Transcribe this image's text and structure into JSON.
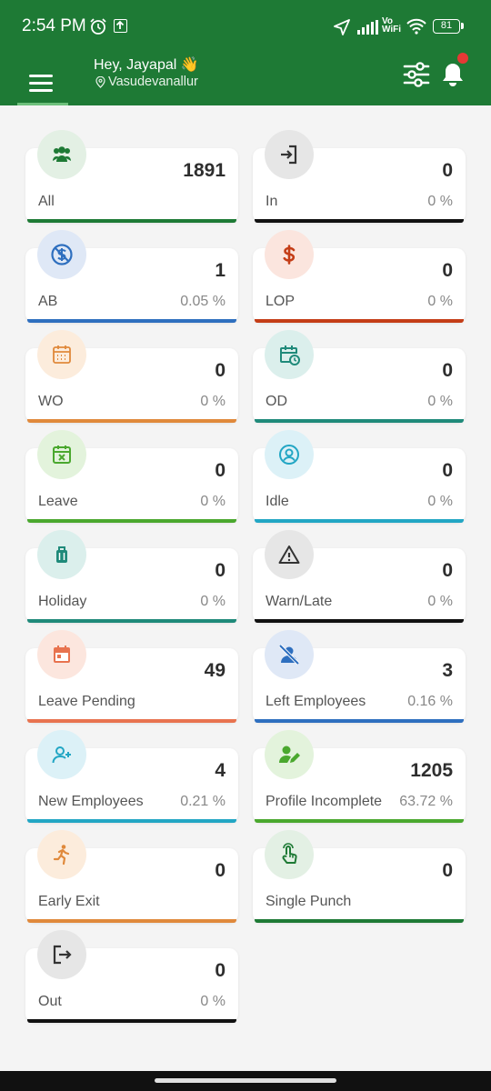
{
  "status_bar": {
    "time": "2:54 PM",
    "network": "Vo\nWiFi",
    "battery": "81"
  },
  "header": {
    "greeting": "Hey, Jayapal 👋",
    "location": "Vasudevanallur"
  },
  "colors": {
    "brand": "#1e7a35"
  },
  "cards": [
    {
      "label": "All",
      "count": "1891",
      "percent": "",
      "icon": "people-icon",
      "bar": "#1e7a35",
      "bg": "#e3f0e4",
      "fg": "#1e7a35"
    },
    {
      "label": "In",
      "count": "0",
      "percent": "0 %",
      "icon": "login-icon",
      "bar": "#111111",
      "bg": "#e6e6e6",
      "fg": "#333333"
    },
    {
      "label": "AB",
      "count": "1",
      "percent": "0.05 %",
      "icon": "absent-icon",
      "bar": "#2e6fbf",
      "bg": "#dfe8f6",
      "fg": "#2e6fbf"
    },
    {
      "label": "LOP",
      "count": "0",
      "percent": "0 %",
      "icon": "dollar-icon",
      "bar": "#c43d17",
      "bg": "#fbe5de",
      "fg": "#c43d17"
    },
    {
      "label": "WO",
      "count": "0",
      "percent": "0 %",
      "icon": "calendar-icon",
      "bar": "#e0893b",
      "bg": "#fcecdc",
      "fg": "#e0893b"
    },
    {
      "label": "OD",
      "count": "0",
      "percent": "0 %",
      "icon": "calendar-clock-icon",
      "bar": "#1f8a7a",
      "bg": "#dbefec",
      "fg": "#1f8a7a"
    },
    {
      "label": "Leave",
      "count": "0",
      "percent": "0 %",
      "icon": "calendar-x-icon",
      "bar": "#4aa82e",
      "bg": "#e3f3dc",
      "fg": "#4aa82e"
    },
    {
      "label": "Idle",
      "count": "0",
      "percent": "0 %",
      "icon": "user-circle-icon",
      "bar": "#22a6c4",
      "bg": "#dcf1f7",
      "fg": "#22a6c4"
    },
    {
      "label": "Holiday",
      "count": "0",
      "percent": "0 %",
      "icon": "luggage-icon",
      "bar": "#1f8a7a",
      "bg": "#dbefec",
      "fg": "#1f8a7a"
    },
    {
      "label": "Warn/Late",
      "count": "0",
      "percent": "0 %",
      "icon": "warning-icon",
      "bar": "#111111",
      "bg": "#e6e6e6",
      "fg": "#333333"
    },
    {
      "label": "Leave Pending",
      "count": "49",
      "percent": "",
      "icon": "calendar-pending-icon",
      "bar": "#e8734f",
      "bg": "#fce6de",
      "fg": "#e8734f"
    },
    {
      "label": "Left Employees",
      "count": "3",
      "percent": "0.16 %",
      "icon": "user-off-icon",
      "bar": "#2e6fbf",
      "bg": "#dfe8f6",
      "fg": "#2e6fbf"
    },
    {
      "label": "New Employees",
      "count": "4",
      "percent": "0.21 %",
      "icon": "user-plus-icon",
      "bar": "#22a6c4",
      "bg": "#dcf1f7",
      "fg": "#22a6c4"
    },
    {
      "label": "Profile Incomplete",
      "count": "1205",
      "percent": "63.72 %",
      "icon": "user-edit-icon",
      "bar": "#4aa82e",
      "bg": "#e3f3dc",
      "fg": "#4aa82e"
    },
    {
      "label": "Early Exit",
      "count": "0",
      "percent": "",
      "icon": "running-icon",
      "bar": "#e0893b",
      "bg": "#fcecdc",
      "fg": "#e0893b"
    },
    {
      "label": "Single Punch",
      "count": "0",
      "percent": "",
      "icon": "finger-tap-icon",
      "bar": "#1e7a35",
      "bg": "#e3f0e4",
      "fg": "#1e7a35"
    },
    {
      "label": "Out",
      "count": "0",
      "percent": "0 %",
      "icon": "logout-icon",
      "bar": "#111111",
      "bg": "#e6e6e6",
      "fg": "#333333"
    }
  ]
}
